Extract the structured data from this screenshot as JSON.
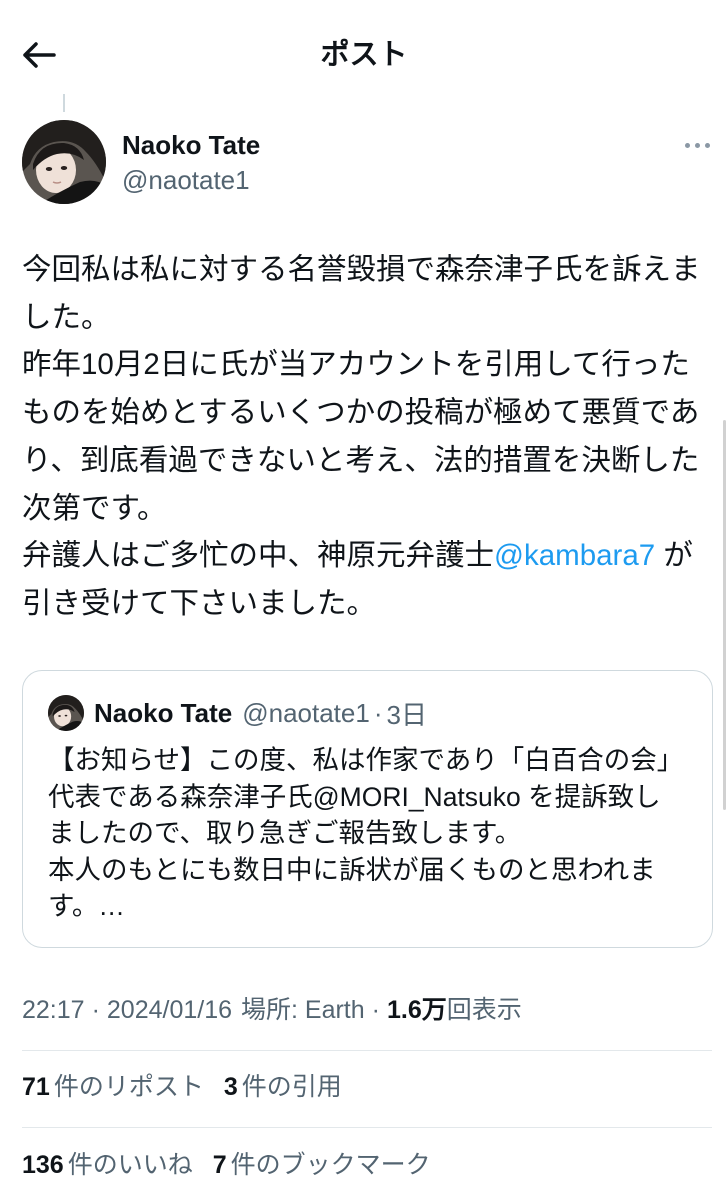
{
  "header": {
    "title": "ポスト",
    "back_icon": "arrow-left-icon"
  },
  "post": {
    "author": {
      "name": "Naoko Tate",
      "handle": "@naotate1"
    },
    "more_icon": "more-horizontal-icon",
    "text_lines": [
      "今回私は私に対する名誉毀損で森奈津子氏を訴えま",
      "した。",
      "昨年10月2日に氏が当アカウントを引用して行った",
      "ものを始めとするいくつかの投稿が極めて悪質であ",
      "り、到底看過できないと考え、法的措置を決断した",
      "次第です。",
      {
        "before": "弁護人はご多忙の中、神原元弁護士",
        "mention": "@kambara7",
        "after": " が"
      },
      "引き受けて下さいました。"
    ],
    "quote": {
      "author": {
        "name": "Naoko Tate",
        "handle": "@naotate1",
        "separator": "·",
        "age": "3日"
      },
      "text_lines": [
        "【お知らせ】この度、私は作家であり「白百合の会」",
        "代表である森奈津子氏@MORI_Natsuko を提訴致し",
        "ましたので、取り急ぎご報告致します。",
        "本人のもとにも数日中に訴状が届くものと思われま",
        "す。…"
      ]
    },
    "meta": {
      "time": "22:17",
      "separator": "·",
      "date": "2024/01/16",
      "location": "場所: Earth",
      "views_count": "1.6万",
      "views_label": "回表示"
    },
    "stats": [
      {
        "count": "71",
        "label": "件のリポスト"
      },
      {
        "count": "3",
        "label": "件の引用"
      },
      {
        "count": "136",
        "label": "件のいいね"
      },
      {
        "count": "7",
        "label": "件のブックマーク"
      }
    ]
  },
  "colors": {
    "text": "#0f1419",
    "secondary": "#536471",
    "link": "#1d9bf0",
    "border": "#cfd9de",
    "divider": "#e3e8eb"
  }
}
